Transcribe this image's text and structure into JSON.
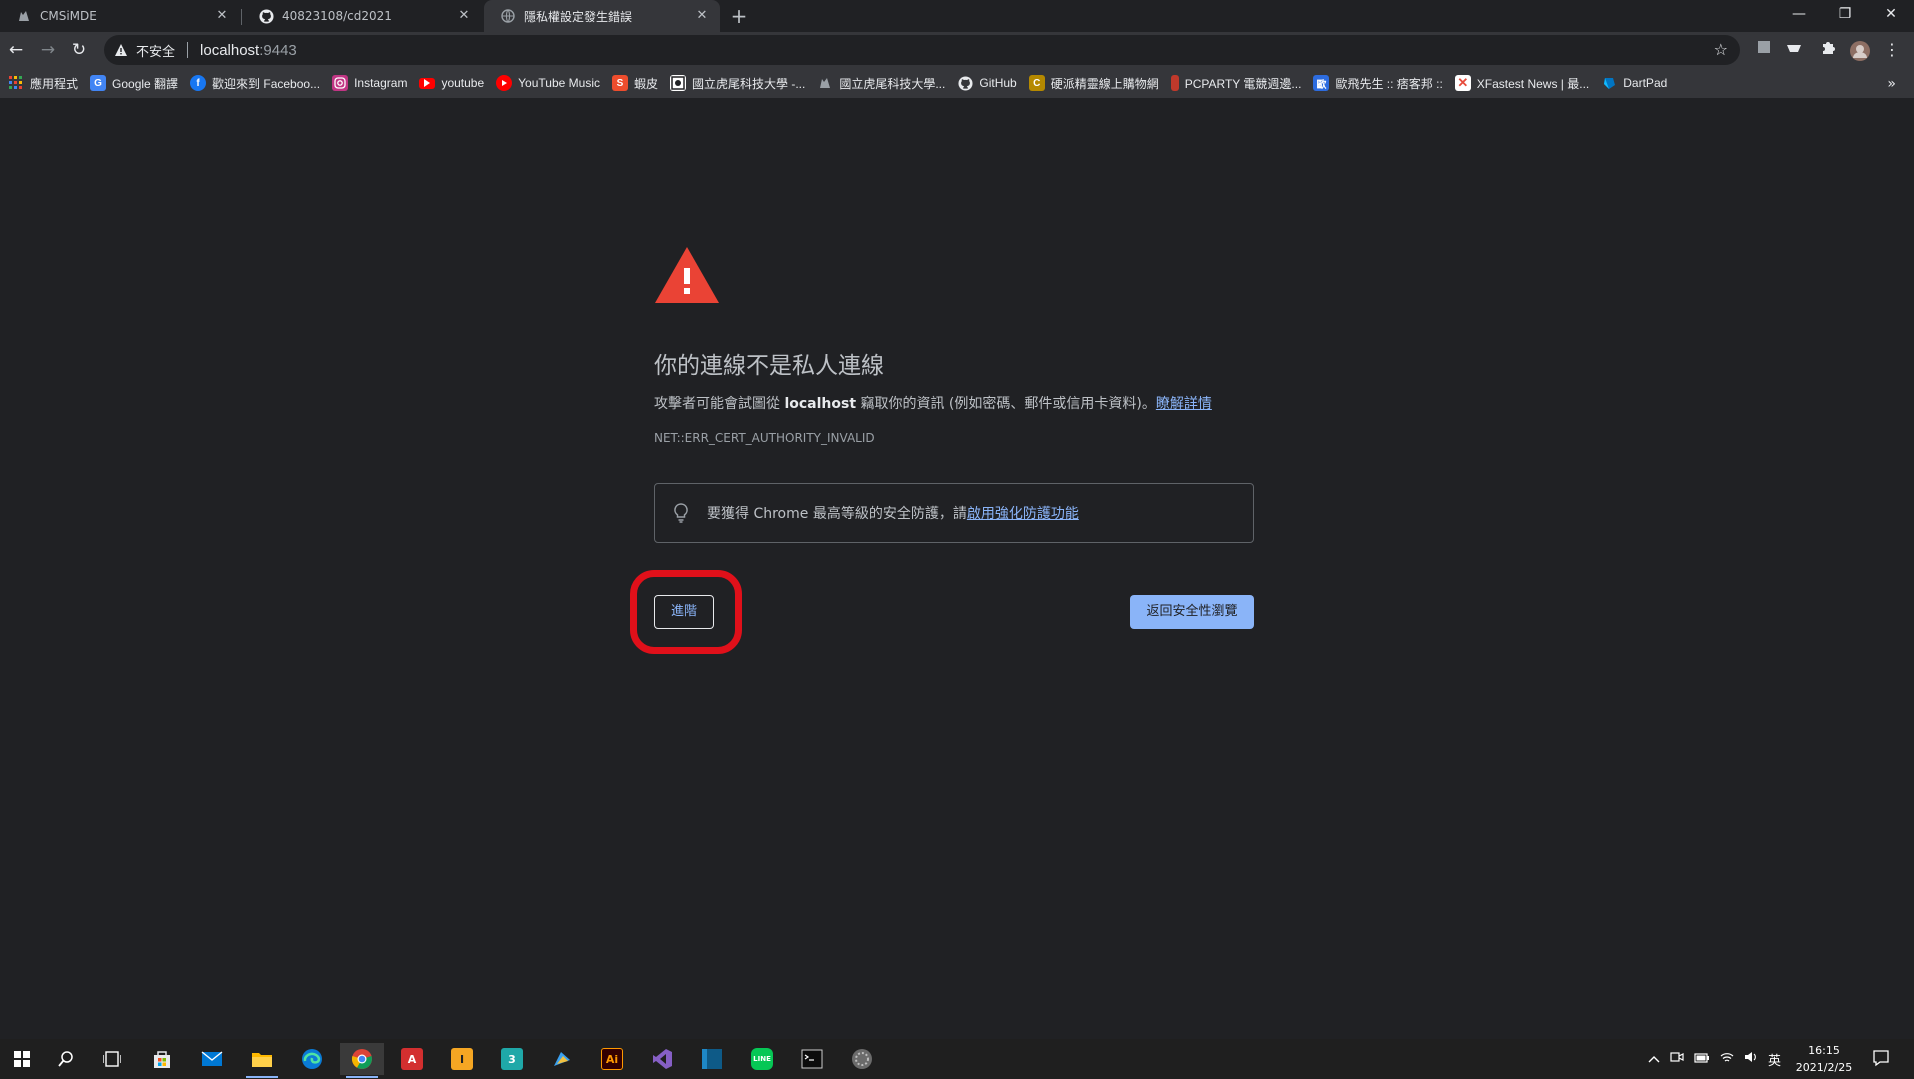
{
  "tabs": [
    {
      "title": "CMSiMDE",
      "icon": "cat-favicon"
    },
    {
      "title": "40823108/cd2021",
      "icon": "github-icon"
    },
    {
      "title": "隱私權設定發生錯誤",
      "icon": "globe-icon"
    }
  ],
  "toolbar": {
    "insecure_label": "不安全",
    "host": "localhost",
    "port": ":9443"
  },
  "bookmarks": [
    {
      "label": "應用程式",
      "icon": "apps-grid-icon",
      "color": "#ea4335"
    },
    {
      "label": "Google 翻譯",
      "icon": "google-translate-icon",
      "color": "#4285f4"
    },
    {
      "label": "歡迎來到 Faceboo...",
      "icon": "facebook-icon",
      "color": "#1877f2"
    },
    {
      "label": "Instagram",
      "icon": "instagram-icon",
      "color": "#c13584"
    },
    {
      "label": "youtube",
      "icon": "youtube-icon",
      "color": "#ff0000"
    },
    {
      "label": "YouTube Music",
      "icon": "youtube-music-icon",
      "color": "#ff0000"
    },
    {
      "label": "蝦皮",
      "icon": "shopee-icon",
      "color": "#ee4d2d"
    },
    {
      "label": "國立虎尾科技大學 -...",
      "icon": "nfu-icon",
      "color": "#5f6368"
    },
    {
      "label": "國立虎尾科技大學...",
      "icon": "nfu-cat-icon",
      "color": "#202124"
    },
    {
      "label": "GitHub",
      "icon": "github-icon",
      "color": "#24292e"
    },
    {
      "label": "硬派精靈線上購物網",
      "icon": "coolpc-icon",
      "color": "#b58900"
    },
    {
      "label": "PCPARTY 電競週邊...",
      "icon": "pcparty-icon",
      "color": "#c0392b"
    },
    {
      "label": "歐飛先生 :: 痞客邦 ::",
      "icon": "pixnet-icon",
      "color": "#2d6cdf"
    },
    {
      "label": "XFastest News | 最...",
      "icon": "xfastest-icon",
      "color": "#e74c3c"
    },
    {
      "label": "DartPad",
      "icon": "dart-icon",
      "color": "#0175c2"
    }
  ],
  "interstitial": {
    "heading": "你的連線不是私人連線",
    "desc_before": "攻擊者可能會試圖從 ",
    "desc_host": "localhost",
    "desc_after": " 竊取你的資訊 (例如密碼、郵件或信用卡資料)。",
    "learn_more": "瞭解詳情",
    "error_code": "NET::ERR_CERT_AUTHORITY_INVALID",
    "enhanced_text": "要獲得 Chrome 最高等級的安全防護，請",
    "enhanced_link": "啟用強化防護功能",
    "advanced_button": "進階",
    "back_button": "返回安全性瀏覽"
  },
  "taskbar": {
    "apps": [
      {
        "name": "windows-start-icon",
        "label": ""
      },
      {
        "name": "search-icon",
        "label": ""
      },
      {
        "name": "task-view-icon",
        "label": ""
      },
      {
        "name": "microsoft-store-icon",
        "label": ""
      },
      {
        "name": "mail-icon",
        "label": ""
      },
      {
        "name": "file-explorer-icon",
        "label": ""
      },
      {
        "name": "edge-icon",
        "label": ""
      },
      {
        "name": "chrome-icon",
        "label": ""
      },
      {
        "name": "acrobat-icon",
        "label": "A"
      },
      {
        "name": "inventor-icon",
        "label": "I"
      },
      {
        "name": "3dsmax-icon",
        "label": "3"
      },
      {
        "name": "paint-app-icon",
        "label": ""
      },
      {
        "name": "illustrator-icon",
        "label": "Ai"
      },
      {
        "name": "visual-studio-icon",
        "label": ""
      },
      {
        "name": "app-blue-icon",
        "label": ""
      },
      {
        "name": "line-icon",
        "label": "LINE"
      },
      {
        "name": "terminal-icon",
        "label": ""
      },
      {
        "name": "app-round-icon",
        "label": ""
      }
    ],
    "ime": "英",
    "time": "16:15",
    "date": "2021/2/25"
  }
}
